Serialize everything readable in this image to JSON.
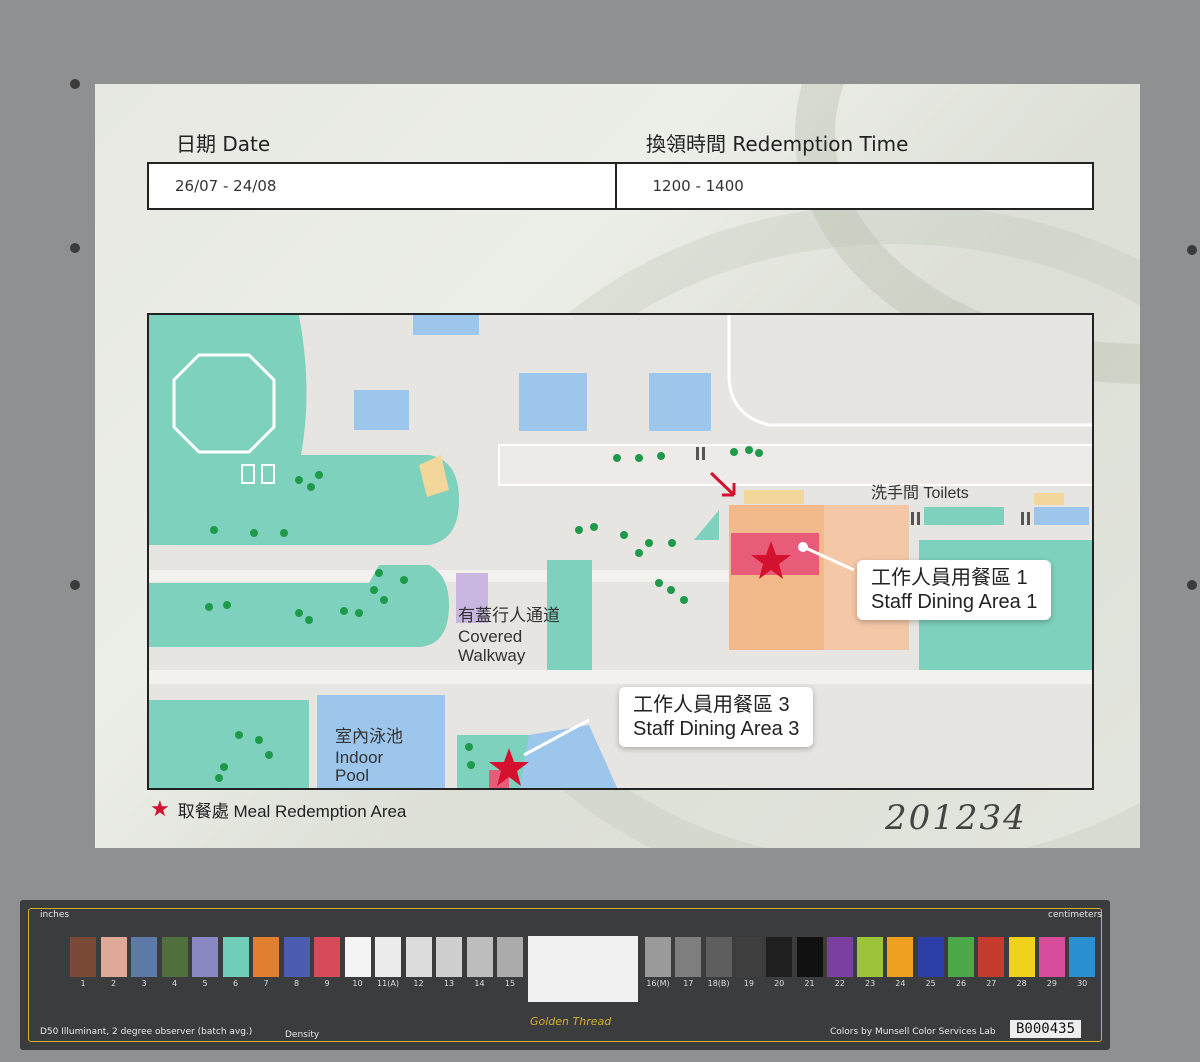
{
  "ticket": {
    "date_label": "日期 Date",
    "time_label": "換領時間 Redemption Time",
    "date_value": "26/07 - 24/08",
    "time_value": "1200 - 1400"
  },
  "map": {
    "toilets": "洗手間 Toilets",
    "walkway_zh": "有蓋行人通道",
    "walkway_en1": "Covered",
    "walkway_en2": "Walkway",
    "pool_zh": "室內泳池",
    "pool_en1": "Indoor",
    "pool_en2": "Pool",
    "area1_zh": "工作人員用餐區 1",
    "area1_en": "Staff Dining Area 1",
    "area3_zh": "工作人員用餐區 3",
    "area3_en": "Staff Dining Area 3"
  },
  "legend": {
    "text": "取餐處 Meal Redemption Area"
  },
  "handwritten_number": "201234",
  "target": {
    "inches": "inches",
    "centimeters": "centimeters",
    "illuminant": "D50 Illuminant, 2 degree observer (batch avg.)",
    "density": "Density",
    "brand": "Golden Thread",
    "munsell": "Colors by Munsell Color Services Lab",
    "barcode": "B000435",
    "swatch_numbers": [
      "1",
      "2",
      "3",
      "4",
      "5",
      "6",
      "7",
      "8",
      "9",
      "10",
      "11(A)",
      "12",
      "13",
      "14",
      "15",
      "16(M)",
      "17",
      "18(B)",
      "19",
      "20",
      "21",
      "22",
      "23",
      "24",
      "25",
      "26",
      "27",
      "28",
      "29",
      "30"
    ]
  },
  "colors": {
    "star": "#d4112e",
    "teal": "#7ed1bc",
    "blue": "#9cc6ec",
    "orange": "#f2b98a",
    "pink": "#e85c7a"
  }
}
